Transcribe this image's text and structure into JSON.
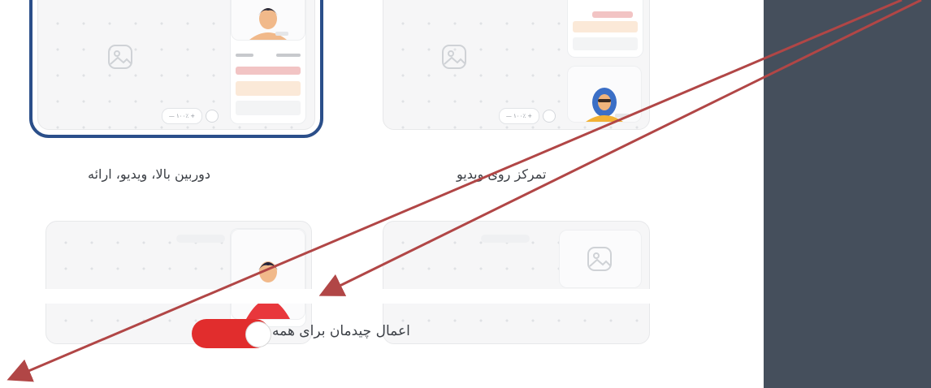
{
  "layouts": [
    {
      "label": "دوربین بالا، ویدیو، ارائه",
      "selected": true,
      "zoom_text": "— ۱۰۰٪ +"
    },
    {
      "label": "تمرکز روی ویدیو",
      "selected": false,
      "zoom_text": "— ۱۰۰٪ +"
    }
  ],
  "toggle": {
    "label": "اعمال چیدمان برای همه",
    "on": true
  },
  "colors": {
    "accent": "#e12d2d",
    "selected_border": "#2b4f8a",
    "panel": "#454f5c",
    "arrow": "#b14646"
  }
}
